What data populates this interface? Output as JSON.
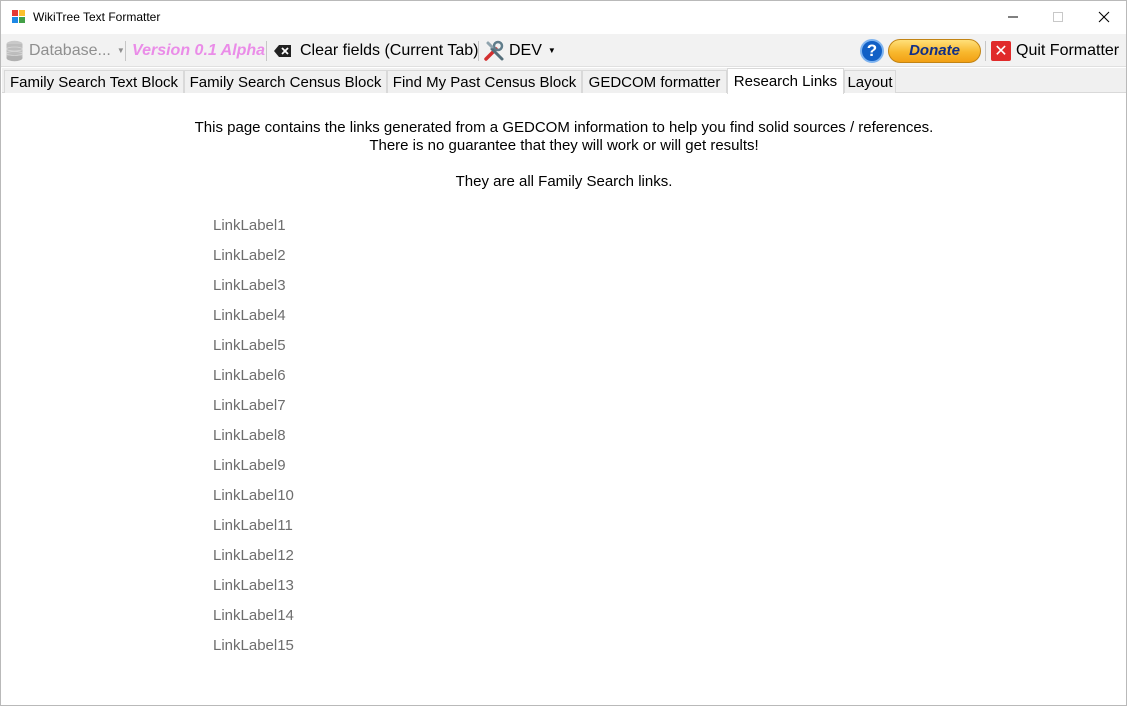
{
  "window": {
    "title": "WikiTree Text Formatter",
    "controls": {
      "minimize": "—",
      "maximize": "☐",
      "close": "✕"
    }
  },
  "toolbar": {
    "database_label": "Database...",
    "version_label": "Version 0.1 Alpha",
    "clear_label": "Clear fields (Current Tab)",
    "dev_label": "DEV",
    "help_glyph": "?",
    "donate_label": "Donate",
    "quit_glyph": "✕",
    "quit_label": "Quit Formatter"
  },
  "tabs": [
    {
      "label": "Family Search Text Block",
      "active": false
    },
    {
      "label": "Family Search Census Block",
      "active": false
    },
    {
      "label": "Find My Past Census Block",
      "active": false
    },
    {
      "label": "GEDCOM formatter",
      "active": false
    },
    {
      "label": "Research Links",
      "active": true
    },
    {
      "label": "Layout",
      "active": false
    }
  ],
  "content": {
    "intro_line1": "This page contains the links generated from a GEDCOM information to help you find solid sources / references.",
    "intro_line2": "There is no guarantee that they will work or will get results!",
    "intro_line3": "They are all Family Search links.",
    "links": [
      "LinkLabel1",
      "LinkLabel2",
      "LinkLabel3",
      "LinkLabel4",
      "LinkLabel5",
      "LinkLabel6",
      "LinkLabel7",
      "LinkLabel8",
      "LinkLabel9",
      "LinkLabel10",
      "LinkLabel11",
      "LinkLabel12",
      "LinkLabel13",
      "LinkLabel14",
      "LinkLabel15"
    ]
  },
  "colors": {
    "version": "#ea8ce8",
    "link": "#6d6d6d",
    "donate": "#f8b82e",
    "help": "#1160c6",
    "quit": "#e02a2a"
  }
}
